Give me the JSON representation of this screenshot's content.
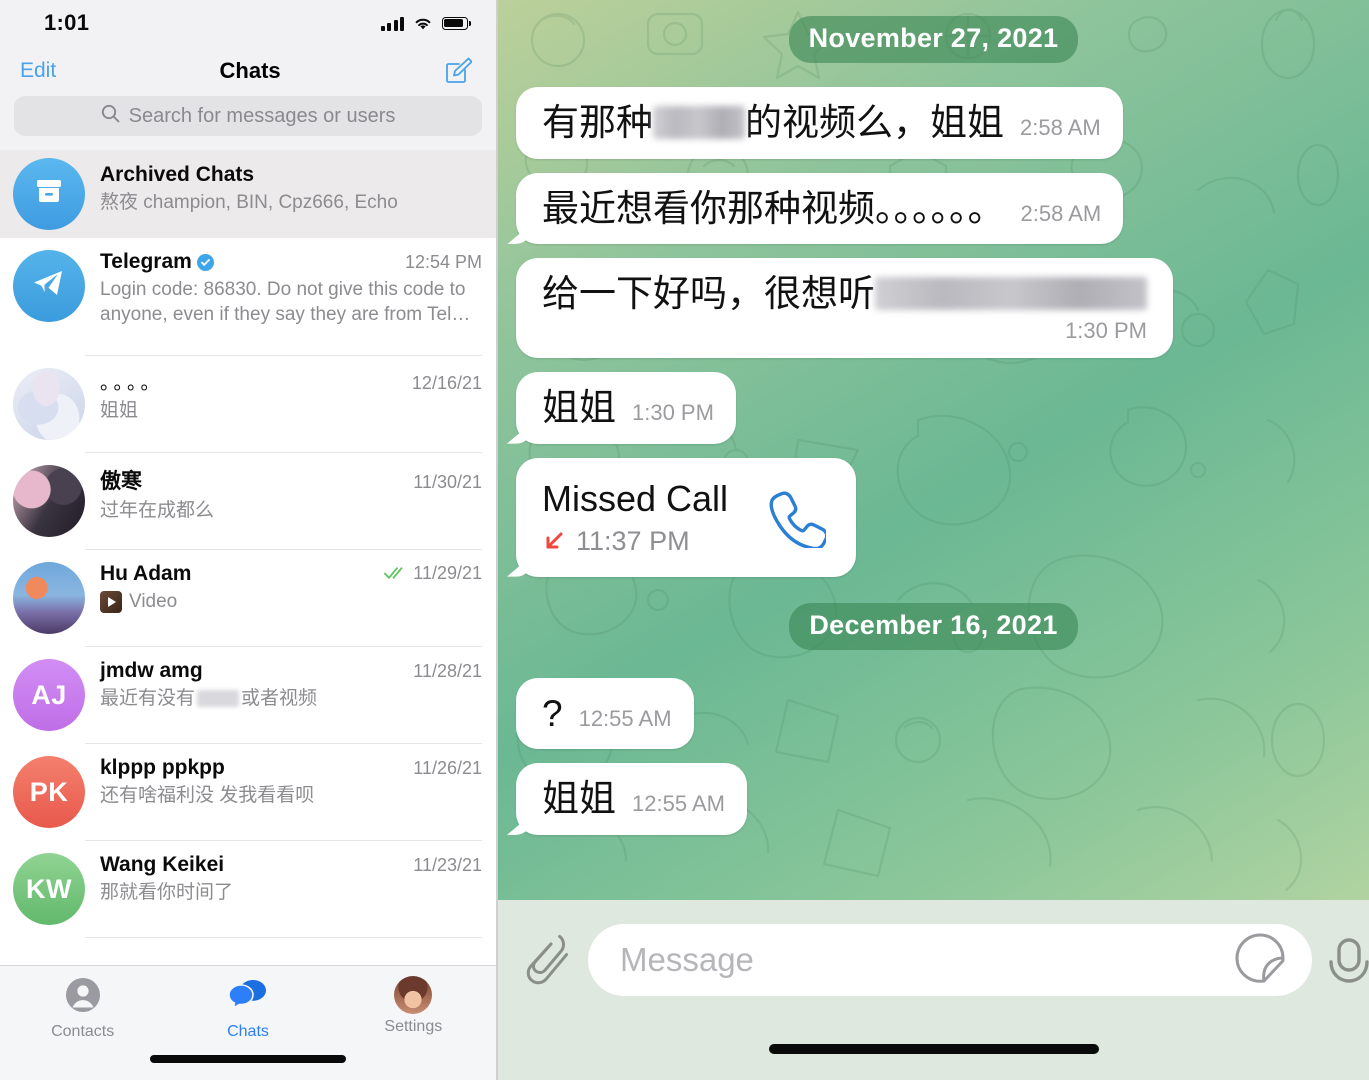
{
  "left": {
    "status_bar": {
      "time": "1:01",
      "signal_icon": "cellular-bars-icon",
      "wifi_icon": "wifi-icon",
      "battery_icon": "battery-icon"
    },
    "nav": {
      "edit_label": "Edit",
      "title": "Chats",
      "compose_icon": "compose-icon"
    },
    "search": {
      "placeholder": "Search for messages or users",
      "icon": "search-icon"
    },
    "chats": [
      {
        "name": "Archived Chats",
        "preview": "熬夜 champion, BIN, Cpz666, Echo",
        "time": "",
        "avatar_type": "archive",
        "avatar_text": "",
        "avatar_color": "#4aa8e8",
        "archived": true
      },
      {
        "name": "Telegram",
        "preview": "Login code: 86830. Do not give this code to anyone, even if they say they are from Tel…",
        "time": "12:54 PM",
        "avatar_type": "telegram",
        "avatar_text": "",
        "avatar_color": "#4aa8e8",
        "verified": true
      },
      {
        "name": "。。。。",
        "preview": "姐姐",
        "time": "12/16/21",
        "avatar_type": "photo-anime-white",
        "avatar_text": "",
        "avatar_color": "#dfe6f2"
      },
      {
        "name": "傲寒",
        "preview": "过年在成都么",
        "time": "11/30/21",
        "avatar_type": "photo-couple",
        "avatar_text": "",
        "avatar_color": "#2a2230"
      },
      {
        "name": "Hu Adam",
        "preview": "Video",
        "time": "11/29/21",
        "avatar_type": "photo-scenery",
        "avatar_text": "",
        "avatar_color": "#6f8fc4",
        "read_receipt": "double-check",
        "attachment_icon": "video-thumb-icon"
      },
      {
        "name": "jmdw amg",
        "preview_before": "最近有没有",
        "preview_after": "或者视频",
        "preview_redacted": true,
        "time": "11/28/21",
        "avatar_type": "initials",
        "avatar_text": "AJ",
        "avatar_color": "#c77ceb"
      },
      {
        "name": "klppp ppkpp",
        "preview": "还有啥福利没 发我看看呗",
        "time": "11/26/21",
        "avatar_type": "initials",
        "avatar_text": "PK",
        "avatar_color": "#ef6f5e"
      },
      {
        "name": "Wang Keikei",
        "preview": "那就看你时间了",
        "time": "11/23/21",
        "avatar_type": "initials",
        "avatar_text": "KW",
        "avatar_color": "#7ac47f"
      }
    ],
    "tabs": [
      {
        "label": "Contacts",
        "icon": "contacts-icon",
        "active": false
      },
      {
        "label": "Chats",
        "icon": "chats-icon",
        "active": true
      },
      {
        "label": "Settings",
        "icon": "settings-avatar-icon",
        "active": false
      }
    ]
  },
  "right": {
    "messages": [
      {
        "kind": "date",
        "text": "November 27, 2021"
      },
      {
        "kind": "text",
        "text_before": "有那种",
        "redacted": true,
        "text_after": "的视频么，姐姐",
        "time": "2:58 AM",
        "tail": false
      },
      {
        "kind": "text",
        "text_before": "最近想看你那种视频。。。。。。",
        "redacted": false,
        "text_after": "",
        "time": "2:58 AM",
        "tail": true
      },
      {
        "kind": "text_wrap",
        "text_before": "给一下好吗，很想听",
        "redacted": true,
        "text_after": "",
        "time": "1:30 PM",
        "tail": false
      },
      {
        "kind": "text",
        "text_before": "姐姐",
        "redacted": false,
        "text_after": "",
        "time": "1:30 PM",
        "tail": true
      },
      {
        "kind": "call",
        "title": "Missed Call",
        "time": "11:37 PM",
        "direction_icon": "arrow-missed-incoming-icon",
        "call_icon": "phone-icon",
        "tail": true
      },
      {
        "kind": "date",
        "text": "December 16, 2021"
      },
      {
        "kind": "text",
        "text_before": "?",
        "redacted": false,
        "text_after": "",
        "time": "12:55 AM",
        "tail": false
      },
      {
        "kind": "text",
        "text_before": "姐姐",
        "redacted": false,
        "text_after": "",
        "time": "12:55 AM",
        "tail": true
      }
    ],
    "input": {
      "placeholder": "Message",
      "attach_icon": "paperclip-icon",
      "sticker_icon": "sticker-icon",
      "mic_icon": "microphone-icon"
    }
  },
  "colors": {
    "accent_blue": "#2d7ff9",
    "link_blue": "#4aa3e8",
    "date_chip_green": "#3c8755",
    "read_check_green": "#62c462"
  }
}
